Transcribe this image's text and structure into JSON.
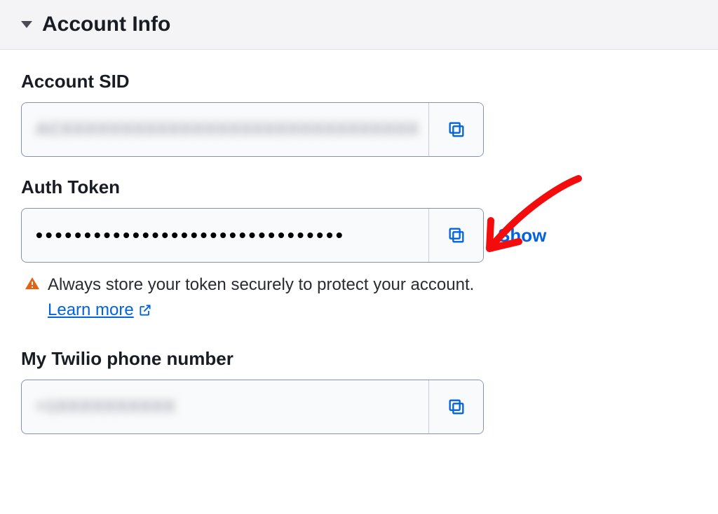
{
  "header": {
    "title": "Account Info"
  },
  "fields": {
    "account_sid": {
      "label": "Account SID",
      "value": "ACXXXXXXXXXXXXXXXXXXXXXXXXXXXXXX"
    },
    "auth_token": {
      "label": "Auth Token",
      "masked_value": "••••••••••••••••••••••••••••••••",
      "show_label": "Show"
    },
    "phone": {
      "label": "My Twilio phone number",
      "value": "+1XXXXXXXXXX"
    }
  },
  "warning": {
    "text_prefix": "Always store your token securely to protect your account. ",
    "learn_more": "Learn more"
  },
  "colors": {
    "link": "#0263e0",
    "warning_icon": "#e46216",
    "annotation": "#f40b0b"
  }
}
